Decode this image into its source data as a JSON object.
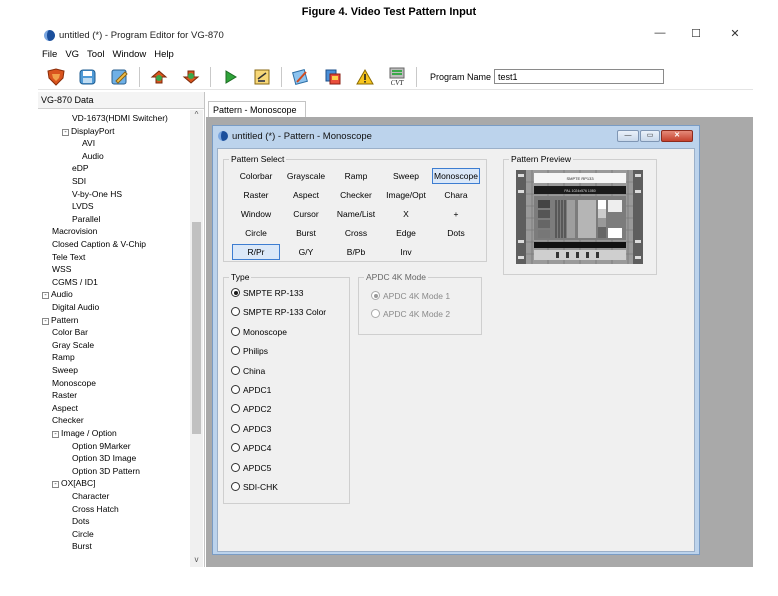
{
  "caption": "Figure 4. Video Test Pattern Input",
  "window": {
    "title": "untitled (*) - Program Editor for VG-870",
    "minimize_glyph": "—",
    "maximize_glyph": "☐",
    "close_glyph": "✕"
  },
  "menu": [
    "File",
    "VG",
    "Tool",
    "Window",
    "Help"
  ],
  "toolbar": {
    "icons": [
      "shield-open-icon",
      "save-icon",
      "edit-icon",
      "upload-icon",
      "download-icon",
      "play-icon",
      "document-icon",
      "tools-icon",
      "transfer-icon",
      "warning-icon",
      "cvt-icon"
    ],
    "program_name_label": "Program Name",
    "program_name_value": "test1"
  },
  "left_panel": {
    "header": "VG-870 Data",
    "tree": [
      {
        "label": "VD-1673(HDMI Switcher)",
        "indent": 3,
        "toggle": ""
      },
      {
        "label": "DisplayPort",
        "indent": 2,
        "toggle": "-"
      },
      {
        "label": "AVI",
        "indent": 4,
        "toggle": ""
      },
      {
        "label": "Audio",
        "indent": 4,
        "toggle": ""
      },
      {
        "label": "eDP",
        "indent": 3,
        "toggle": ""
      },
      {
        "label": "SDI",
        "indent": 3,
        "toggle": ""
      },
      {
        "label": "V-by-One HS",
        "indent": 3,
        "toggle": ""
      },
      {
        "label": "LVDS",
        "indent": 3,
        "toggle": ""
      },
      {
        "label": "Parallel",
        "indent": 3,
        "toggle": ""
      },
      {
        "label": "Macrovision",
        "indent": 1,
        "toggle": ""
      },
      {
        "label": "Closed Caption & V-Chip",
        "indent": 1,
        "toggle": ""
      },
      {
        "label": "Tele Text",
        "indent": 1,
        "toggle": ""
      },
      {
        "label": "WSS",
        "indent": 1,
        "toggle": ""
      },
      {
        "label": "CGMS / ID1",
        "indent": 1,
        "toggle": ""
      },
      {
        "label": "Audio",
        "indent": 0,
        "toggle": "-"
      },
      {
        "label": "Digital Audio",
        "indent": 1,
        "toggle": ""
      },
      {
        "label": "Pattern",
        "indent": 0,
        "toggle": "-"
      },
      {
        "label": "Color Bar",
        "indent": 1,
        "toggle": ""
      },
      {
        "label": "Gray Scale",
        "indent": 1,
        "toggle": ""
      },
      {
        "label": "Ramp",
        "indent": 1,
        "toggle": ""
      },
      {
        "label": "Sweep",
        "indent": 1,
        "toggle": ""
      },
      {
        "label": "Monoscope",
        "indent": 1,
        "toggle": ""
      },
      {
        "label": "Raster",
        "indent": 1,
        "toggle": ""
      },
      {
        "label": "Aspect",
        "indent": 1,
        "toggle": ""
      },
      {
        "label": "Checker",
        "indent": 1,
        "toggle": ""
      },
      {
        "label": "Image / Option",
        "indent": 1,
        "toggle": "-"
      },
      {
        "label": "Option 9Marker",
        "indent": 3,
        "toggle": ""
      },
      {
        "label": "Option 3D Image",
        "indent": 3,
        "toggle": ""
      },
      {
        "label": "Option 3D Pattern",
        "indent": 3,
        "toggle": ""
      },
      {
        "label": "OX[ABC]",
        "indent": 1,
        "toggle": "-"
      },
      {
        "label": "Character",
        "indent": 3,
        "toggle": ""
      },
      {
        "label": "Cross Hatch",
        "indent": 3,
        "toggle": ""
      },
      {
        "label": "Dots",
        "indent": 3,
        "toggle": ""
      },
      {
        "label": "Circle",
        "indent": 3,
        "toggle": ""
      },
      {
        "label": "Burst",
        "indent": 3,
        "toggle": ""
      }
    ],
    "scroll_up": "^",
    "scroll_down": "v"
  },
  "right_tab": "Pattern - Monoscope",
  "child_window": {
    "title": "untitled (*) - Pattern - Monoscope",
    "pattern_select": {
      "label": "Pattern Select",
      "rows": [
        [
          "Colorbar",
          "Grayscale",
          "Ramp",
          "Sweep",
          "Monoscope"
        ],
        [
          "Raster",
          "Aspect",
          "Checker",
          "Image/Opt",
          "Chara"
        ],
        [
          "Window",
          "Cursor",
          "Name/List",
          "X",
          "+"
        ],
        [
          "Circle",
          "Burst",
          "Cross",
          "Edge",
          "Dots"
        ],
        [
          "R/Pr",
          "G/Y",
          "B/Pb",
          "Inv"
        ]
      ],
      "selected": [
        "Monoscope",
        "R/Pr"
      ]
    },
    "pattern_preview": {
      "label": "Pattern Preview",
      "banner_text_1": "SMPTE RP133",
      "banner_text_2": "PAL 1024x576 1080"
    },
    "type": {
      "label": "Type",
      "options": [
        "SMPTE RP-133",
        "SMPTE RP-133 Color",
        "Monoscope",
        "Philips",
        "China",
        "APDC1",
        "APDC2",
        "APDC3",
        "APDC4",
        "APDC5",
        "SDI-CHK"
      ],
      "selected": "SMPTE RP-133"
    },
    "apdc_mode": {
      "label": "APDC 4K Mode",
      "options": [
        "APDC 4K Mode 1",
        "APDC 4K Mode 2"
      ],
      "selected": "APDC 4K Mode 1"
    }
  }
}
